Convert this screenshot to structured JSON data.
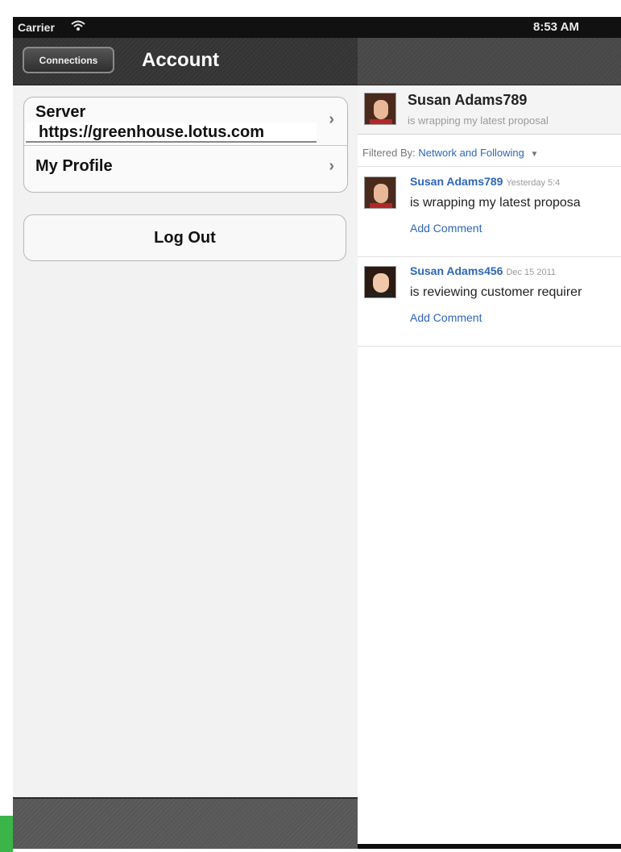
{
  "status_bar": {
    "carrier": "Carrier",
    "time": "8:53 AM",
    "wifi_icon": "wifi-icon"
  },
  "left_panel": {
    "back_button": "Connections",
    "title": "Account",
    "server": {
      "label": "Server",
      "value": "https://greenhouse.lotus.com"
    },
    "my_profile": "My Profile",
    "log_out": "Log Out"
  },
  "feed": {
    "header": {
      "name": "Susan Adams789",
      "status": "is wrapping my latest proposal"
    },
    "filter": {
      "prefix": "Filtered By:",
      "value": "Network and Following"
    },
    "posts": [
      {
        "author": "Susan Adams789",
        "time": "Yesterday 5:4",
        "text": "is wrapping my latest proposa",
        "comment": "Add Comment"
      },
      {
        "author": "Susan Adams456",
        "time": "Dec 15 2011",
        "text": "is reviewing customer requirer",
        "comment": "Add Comment"
      }
    ]
  },
  "colors": {
    "link": "#2e66b8",
    "nav_dark": "#333333"
  }
}
